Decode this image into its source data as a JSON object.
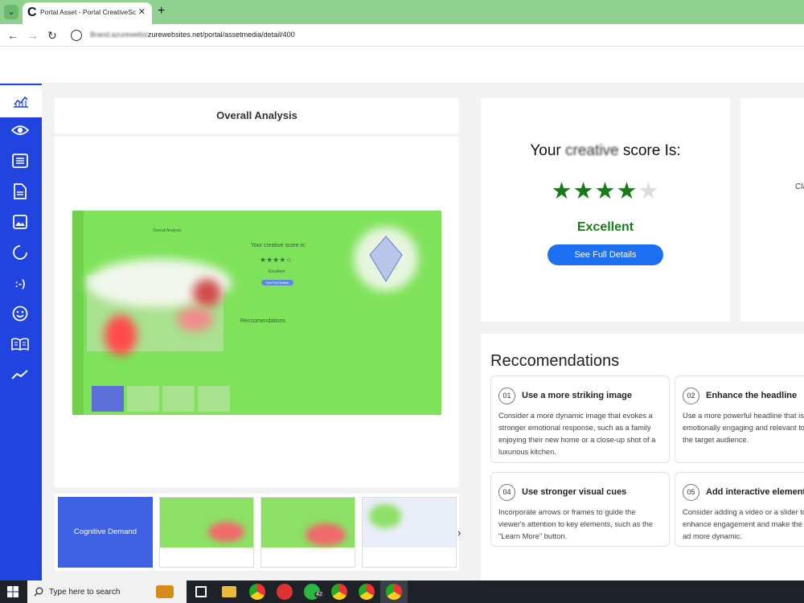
{
  "browser": {
    "tab_title": "Portal Asset - Portal CreativeSc",
    "tab_close": "✕",
    "new_tab": "+",
    "url_obscured": "Brand.azurewebsi",
    "url_visible": "zurewebsites.net/portal/assetmedia/detail/400"
  },
  "sidebar": {
    "items": [
      "analytics",
      "eye",
      "list",
      "document",
      "image",
      "loading",
      "emoticon",
      "smiley",
      "book",
      "trend"
    ]
  },
  "overall_analysis": {
    "title": "Overall Analysis",
    "heatmap": {
      "panel_title": "Overall Analysis",
      "score_text": "Your creative score is:",
      "rating": "Excellent",
      "button": "See Full Details",
      "rec_heading": "Reccomendations"
    }
  },
  "score_card": {
    "title_prefix": "Your",
    "title_obscured": "creative",
    "title_suffix": "score Is:",
    "stars_filled": 4,
    "stars_total": 5,
    "rating": "Excellent",
    "button": "See Full Details"
  },
  "right_card": {
    "text": "Cla"
  },
  "recommendations": {
    "heading": "Reccomendations",
    "items": [
      {
        "num": "01",
        "title": "Use a more striking image",
        "body": "Consider a more dynamic image that evokes a stronger emotional response, such as a family enjoying their new home or a close-up shot of a luxurious kitchen."
      },
      {
        "num": "02",
        "title": "Enhance the headline",
        "body": "Use a more powerful headline that is emotionally engaging and relevant to the target audience."
      },
      {
        "num": "04",
        "title": "Use stronger visual cues",
        "body": "Incorporate arrows or frames to guide the viewer's attention to key elements, such as the \"Learn More\" button."
      },
      {
        "num": "05",
        "title": "Add interactive elements",
        "body": "Consider adding a video or a slider to enhance engagement and make the ad more dynamic."
      }
    ]
  },
  "thumbnails": {
    "items": [
      {
        "caption": "Cognitive Demand"
      }
    ],
    "next": "›"
  },
  "taskbar": {
    "search_placeholder": "Type here to search",
    "whatsapp_badge": "42"
  },
  "colors": {
    "sidebar": "#2144e0",
    "star": "#1a7a1a",
    "button": "#1d6ff2",
    "tabbar": "#8fd18f",
    "heatmap": "#7ee35a"
  }
}
